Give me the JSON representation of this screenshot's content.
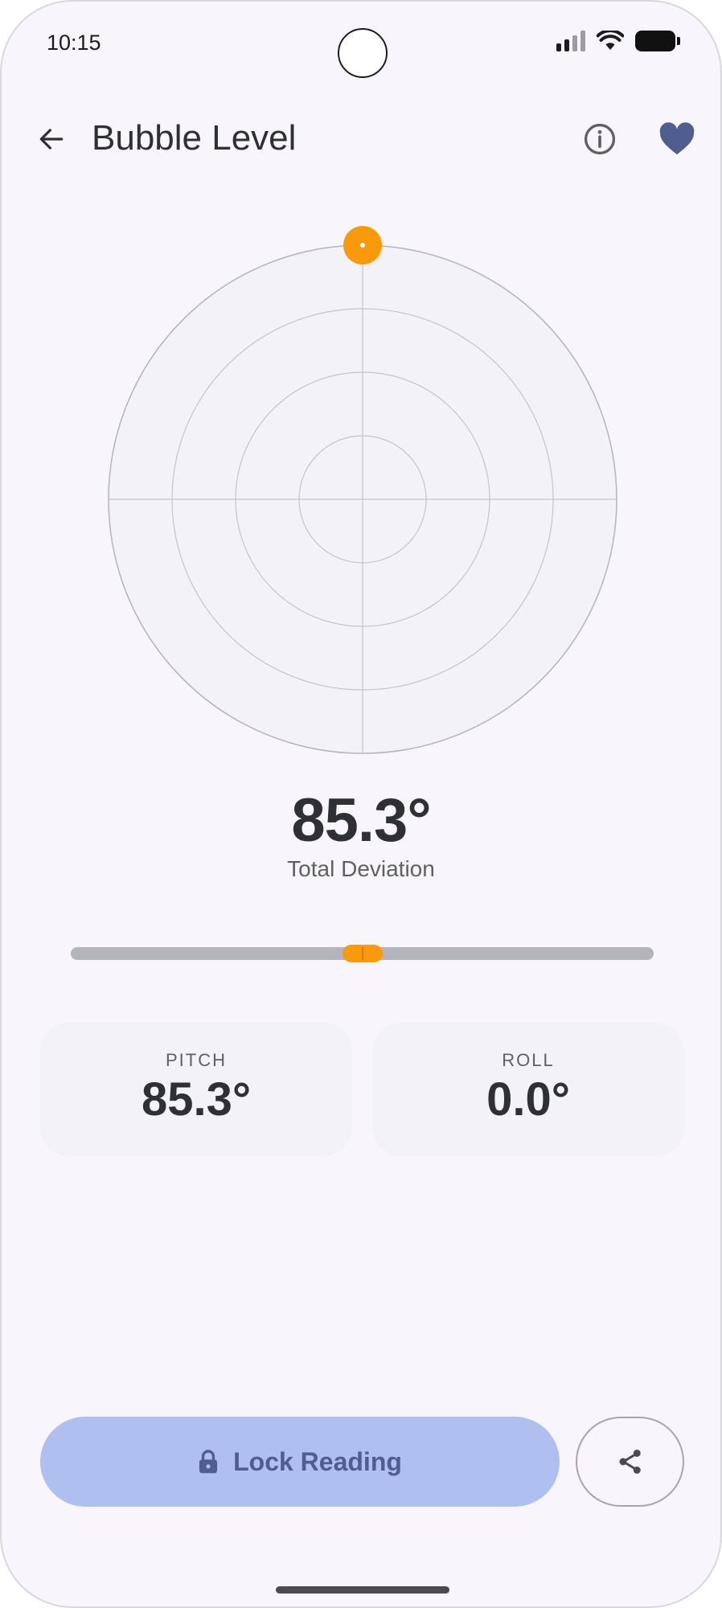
{
  "status_bar": {
    "time": "10:15"
  },
  "app_bar": {
    "title": "Bubble Level"
  },
  "icons": {
    "back": "arrow-left-icon",
    "info": "info-icon",
    "favorite": "heart-icon",
    "lock": "lock-icon",
    "share": "share-icon"
  },
  "level": {
    "total_deviation": "85.3°",
    "total_label": "Total Deviation",
    "pitch_degrees": 85.3,
    "roll_degrees": 0.0,
    "slider_position": 0.5
  },
  "readings": {
    "pitch": {
      "label": "PITCH",
      "value": "85.3°"
    },
    "roll": {
      "label": "ROLL",
      "value": "0.0°"
    }
  },
  "actions": {
    "lock_label": "Lock Reading"
  },
  "colors": {
    "accent_bubble": "#f89a0c",
    "primary_button": "#aebff0",
    "primary_text": "#4f5e8f",
    "favorite": "#4f5e8f"
  }
}
